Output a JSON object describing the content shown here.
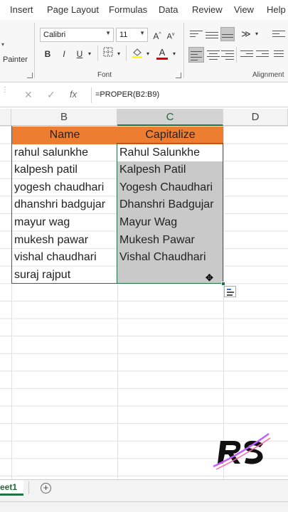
{
  "ribbon": {
    "tabs": [
      "Insert",
      "Page Layout",
      "Formulas",
      "Data",
      "Review",
      "View",
      "Help"
    ],
    "painter_label": "Painter",
    "font_name": "Calibri",
    "font_size": "11",
    "increase_font": "A",
    "decrease_font": "A",
    "bold": "B",
    "italic": "I",
    "underline": "U",
    "font_color_letter": "A",
    "font_group_label": "Font",
    "alignment_group_label": "Alignment"
  },
  "formula_bar": {
    "cancel": "✕",
    "enter": "✓",
    "fx": "fx",
    "formula": "=PROPER(B2:B9)"
  },
  "columns": [
    "B",
    "C",
    "D"
  ],
  "table": {
    "header_name": "Name",
    "header_capitalize": "Capitalize",
    "names": [
      "rahul salunkhe",
      "kalpesh patil",
      "yogesh chaudhari",
      "dhanshri badgujar",
      "mayur wag",
      "mukesh pawar",
      "vishal chaudhari",
      "suraj rajput"
    ],
    "capitalized": [
      "Rahul Salunkhe",
      "Kalpesh Patil",
      "Yogesh Chaudhari",
      "Dhanshri Badgujar",
      "Mayur Wag",
      "Mukesh Pawar",
      "Vishal Chaudhari",
      ""
    ]
  },
  "sheets": {
    "active_tab": "eet1",
    "add_symbol": "+"
  },
  "colors": {
    "header_fill": "#ed7d31",
    "selection_fill": "#c9c9c9",
    "excel_green": "#217346"
  }
}
